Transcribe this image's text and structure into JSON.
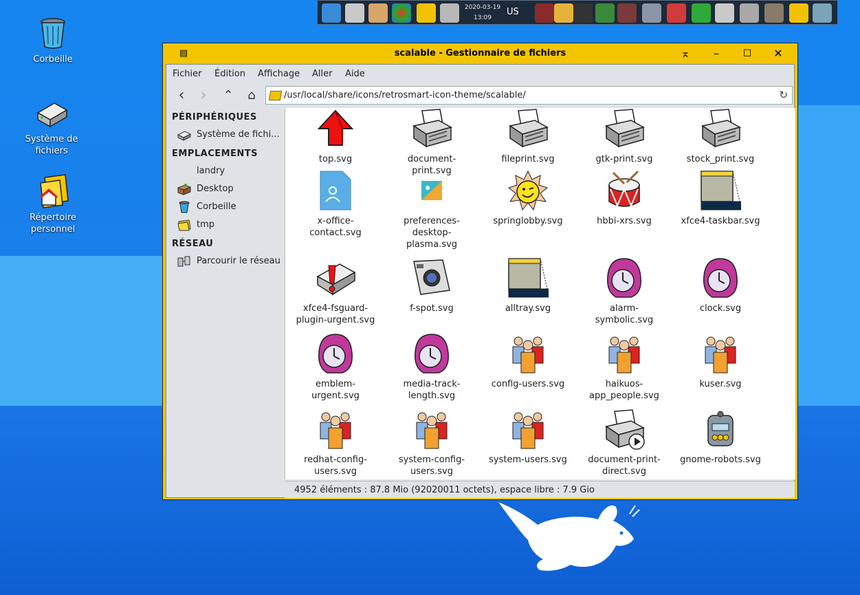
{
  "desktop": {
    "icons": [
      {
        "label": "Corbeille"
      },
      {
        "label": "Système de fichiers"
      },
      {
        "label": "Répertoire personnel"
      }
    ]
  },
  "panel": {
    "date": "2020-03-19",
    "time": "13:09",
    "keyboard_layout": "US"
  },
  "window": {
    "title": "scalable - Gestionnaire de fichiers",
    "menu": [
      "Fichier",
      "Édition",
      "Affichage",
      "Aller",
      "Aide"
    ],
    "address": "/usr/local/share/icons/retrosmart-icon-theme/scalable/",
    "sidebar": {
      "sections": [
        {
          "title": "PÉRIPHÉRIQUES",
          "items": [
            "Système de fichi..."
          ]
        },
        {
          "title": "EMPLACEMENTS",
          "items": [
            "landry",
            "Desktop",
            "Corbeille",
            "tmp"
          ]
        },
        {
          "title": "RÉSEAU",
          "items": [
            "Parcourir le réseau"
          ]
        }
      ]
    },
    "files": [
      {
        "name": "top.svg",
        "icon": "red-arrow-up-icon"
      },
      {
        "name": "document-print.svg",
        "icon": "printer-icon"
      },
      {
        "name": "fileprint.svg",
        "icon": "printer-icon"
      },
      {
        "name": "gtk-print.svg",
        "icon": "printer-icon"
      },
      {
        "name": "stock_print.svg",
        "icon": "printer-icon"
      },
      {
        "name": "x-office-contact.svg",
        "icon": "contact-card-icon"
      },
      {
        "name": "preferences-desktop-plasma.svg",
        "icon": "plasma-icon"
      },
      {
        "name": "springlobby.svg",
        "icon": "smiley-sun-icon"
      },
      {
        "name": "hbbi-xrs.svg",
        "icon": "drum-icon"
      },
      {
        "name": "xfce4-taskbar.svg",
        "icon": "taskbar-icon"
      },
      {
        "name": "xfce4-fsguard-plugin-urgent.svg",
        "icon": "drive-alert-icon"
      },
      {
        "name": "f-spot.svg",
        "icon": "camera-icon"
      },
      {
        "name": "alltray.svg",
        "icon": "taskbar-icon"
      },
      {
        "name": "alarm-symbolic.svg",
        "icon": "clock-icon"
      },
      {
        "name": "clock.svg",
        "icon": "clock-icon"
      },
      {
        "name": "emblem-urgent.svg",
        "icon": "clock-icon"
      },
      {
        "name": "media-track-length.svg",
        "icon": "clock-icon"
      },
      {
        "name": "config-users.svg",
        "icon": "users-icon"
      },
      {
        "name": "haikuos-app_people.svg",
        "icon": "users-icon"
      },
      {
        "name": "kuser.svg",
        "icon": "users-icon"
      },
      {
        "name": "redhat-config-users.svg",
        "icon": "users-icon"
      },
      {
        "name": "system-config-users.svg",
        "icon": "users-icon"
      },
      {
        "name": "system-users.svg",
        "icon": "users-icon"
      },
      {
        "name": "document-print-direct.svg",
        "icon": "printer-play-icon"
      },
      {
        "name": "gnome-robots.svg",
        "icon": "robot-icon"
      }
    ],
    "status": "4952 éléments : 87.8 Mio (92020011 octets), espace libre : 7.9 Gio"
  },
  "colors": {
    "window_frame": "#f3c500",
    "desktop_blue": "#1a6fe0",
    "panel_bg": "#1c2a3a"
  }
}
